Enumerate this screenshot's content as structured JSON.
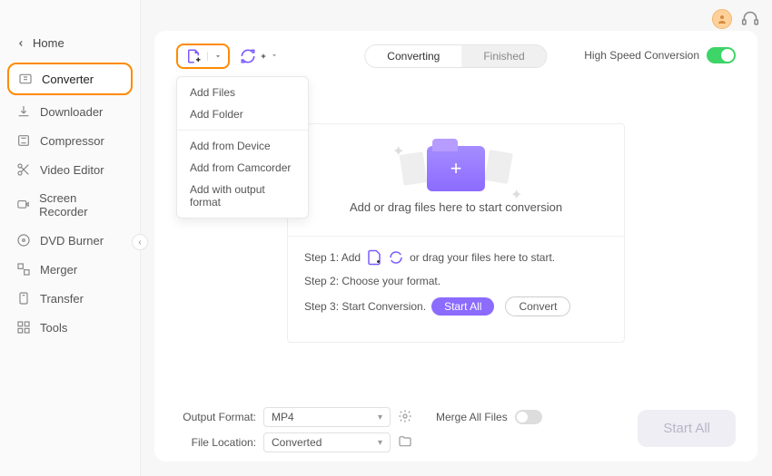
{
  "header": {
    "home": "Home"
  },
  "topbar": {
    "high_speed": "High Speed Conversion"
  },
  "sidebar": {
    "items": [
      {
        "label": "Converter"
      },
      {
        "label": "Downloader"
      },
      {
        "label": "Compressor"
      },
      {
        "label": "Video Editor"
      },
      {
        "label": "Screen Recorder"
      },
      {
        "label": "DVD Burner"
      },
      {
        "label": "Merger"
      },
      {
        "label": "Transfer"
      },
      {
        "label": "Tools"
      }
    ]
  },
  "tabs": {
    "converting": "Converting",
    "finished": "Finished"
  },
  "dropdown": {
    "add_files": "Add Files",
    "add_folder": "Add Folder",
    "add_device": "Add from Device",
    "add_camcorder": "Add from Camcorder",
    "add_format": "Add with output format"
  },
  "drop": {
    "message": "Add or drag files here to start conversion",
    "step1_pre": "Step 1: Add",
    "step1_post": "or drag your files here to start.",
    "step2": "Step 2: Choose your format.",
    "step3": "Step 3: Start Conversion.",
    "start_all": "Start  All",
    "convert": "Convert"
  },
  "bottom": {
    "output_format_label": "Output Format:",
    "output_format_value": "MP4",
    "file_location_label": "File Location:",
    "file_location_value": "Converted",
    "merge": "Merge All Files",
    "start_all_btn": "Start All"
  }
}
